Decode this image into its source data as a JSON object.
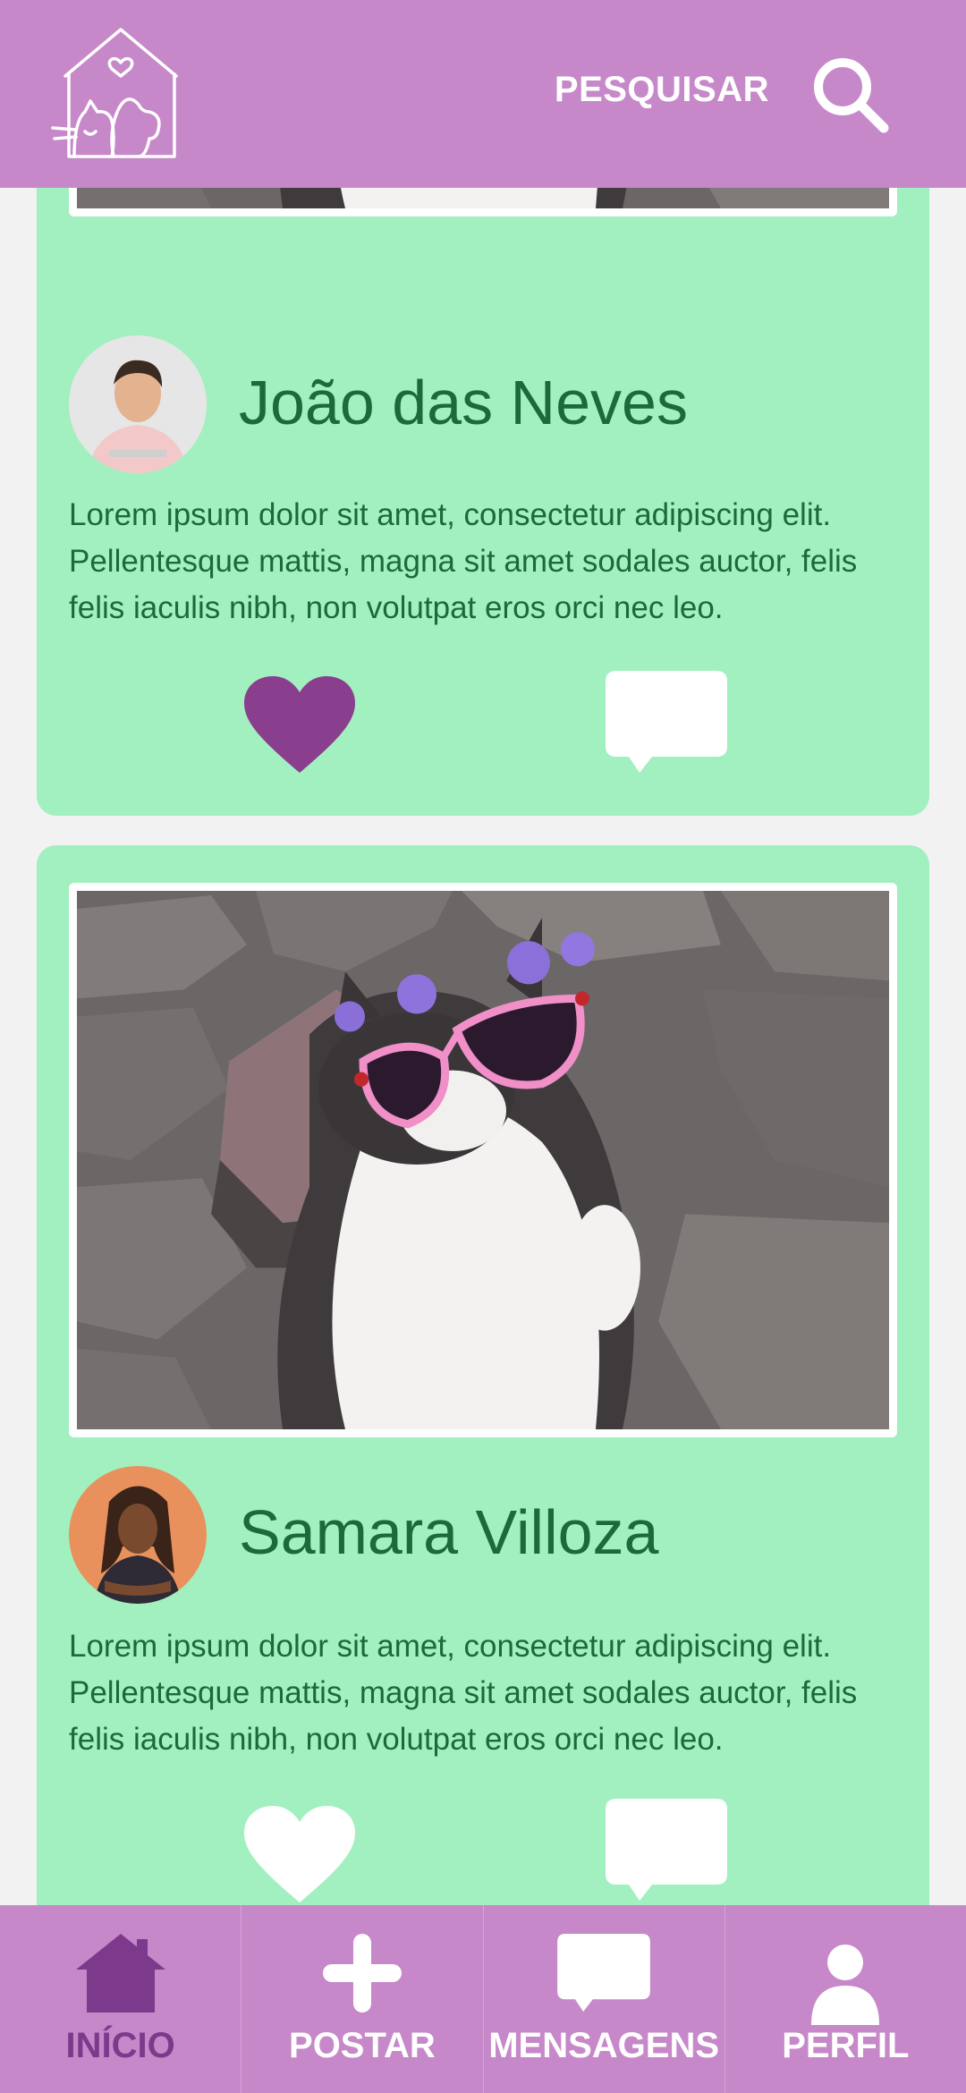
{
  "header": {
    "search_label": "PESQUISAR",
    "logo_icon": "pet-house-logo-icon",
    "search_icon": "search-icon"
  },
  "posts": [
    {
      "author": "João das Neves",
      "text": "Lorem ipsum dolor sit amet, consectetur adipiscing elit. Pellentesque mattis, magna sit amet sodales auctor, felis felis iaculis nibh, non volutpat eros orci nec leo.",
      "liked": true,
      "image": "cat-with-flower-crown-and-sunglasses-photo"
    },
    {
      "author": "Samara Villoza",
      "text": "Lorem ipsum dolor sit amet, consectetur adipiscing elit. Pellentesque mattis, magna sit amet sodales auctor, felis felis iaculis nibh, non volutpat eros orci nec leo.",
      "liked": false,
      "image": "cat-with-flower-crown-and-sunglasses-photo"
    }
  ],
  "bottom_nav": {
    "items": [
      {
        "label": "INÍCIO",
        "icon": "home-icon",
        "active": true
      },
      {
        "label": "POSTAR",
        "icon": "plus-icon",
        "active": false
      },
      {
        "label": "MENSAGENS",
        "icon": "chat-bubble-icon",
        "active": false
      },
      {
        "label": "PERFIL",
        "icon": "user-icon",
        "active": false
      }
    ]
  },
  "colors": {
    "header_bg": "#c688c9",
    "card_bg": "#a2f0bf",
    "text_green": "#1a6b38",
    "heart_liked": "#8a3f8e",
    "nav_active": "#7d3a8c",
    "page_bg": "#f2f2f2"
  }
}
